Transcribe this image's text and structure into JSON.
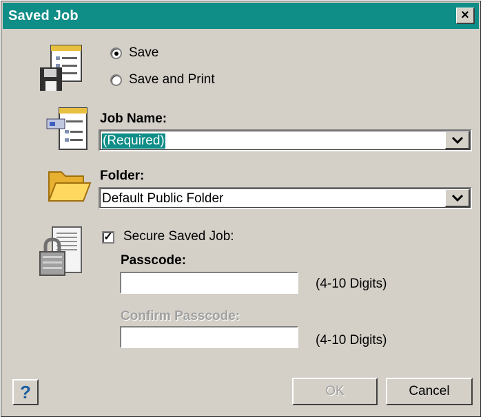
{
  "window": {
    "title": "Saved Job",
    "close_glyph": "×"
  },
  "options": [
    {
      "label": "Save",
      "selected": true
    },
    {
      "label": "Save and Print",
      "selected": false
    }
  ],
  "job_name": {
    "label": "Job Name:",
    "value": "(Required)"
  },
  "folder": {
    "label": "Folder:",
    "value": "Default Public Folder"
  },
  "secure": {
    "label": "Secure Saved Job:",
    "checked": true,
    "passcode_label": "Passcode:",
    "passcode_value": "",
    "passcode_hint": "(4-10 Digits)",
    "confirm_label": "Confirm Passcode:",
    "confirm_value": "",
    "confirm_hint": "(4-10 Digits)"
  },
  "buttons": {
    "help": "?",
    "ok": "OK",
    "cancel": "Cancel"
  },
  "icons": [
    "save-print-icon",
    "job-name-icon",
    "folder-icon",
    "secure-lock-icon",
    "chevron-down-icon",
    "help-icon"
  ],
  "colors": {
    "titlebar": "#0f8d87",
    "dialog_bg": "#d4d0c8"
  }
}
